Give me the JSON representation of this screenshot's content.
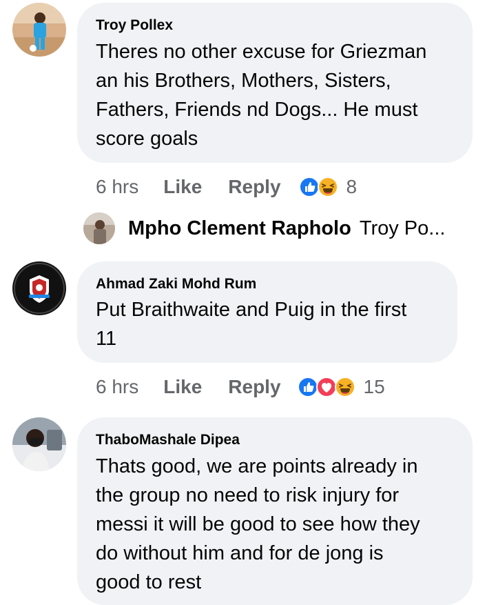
{
  "comments": [
    {
      "author": "Troy Pollex",
      "lines": [
        "Theres no other excuse for Griezman",
        "an his Brothers, Mothers, Sisters,",
        "Fathers, Friends nd Dogs... He must",
        "score goals"
      ],
      "time": "6 hrs",
      "like_label": "Like",
      "reply_label": "Reply",
      "reactions": [
        "like-reaction-icon",
        "haha-reaction-icon"
      ],
      "reaction_count": "8",
      "reply_preview": {
        "author": "Mpho Clement Rapholo",
        "snippet": "Troy Po..."
      }
    },
    {
      "author": "Ahmad Zaki Mohd Rum",
      "lines": [
        "Put Braithwaite and Puig in the first",
        "11"
      ],
      "time": "6 hrs",
      "like_label": "Like",
      "reply_label": "Reply",
      "reactions": [
        "like-reaction-icon",
        "love-reaction-icon",
        "haha-reaction-icon"
      ],
      "reaction_count": "15"
    },
    {
      "author": "ThaboMashale Dipea",
      "lines": [
        "Thats good, we are points already in",
        "the group no need to risk injury for",
        "messi it will be good to see how they",
        "do without him and for de jong is",
        "good to rest"
      ]
    }
  ],
  "colors": {
    "bubble": "#f0f2f5",
    "primary_text": "#050505",
    "secondary_text": "#65676b",
    "like_blue": "#1877f2",
    "love_red": "#f33e58",
    "haha_yellow": "#f7b125"
  }
}
